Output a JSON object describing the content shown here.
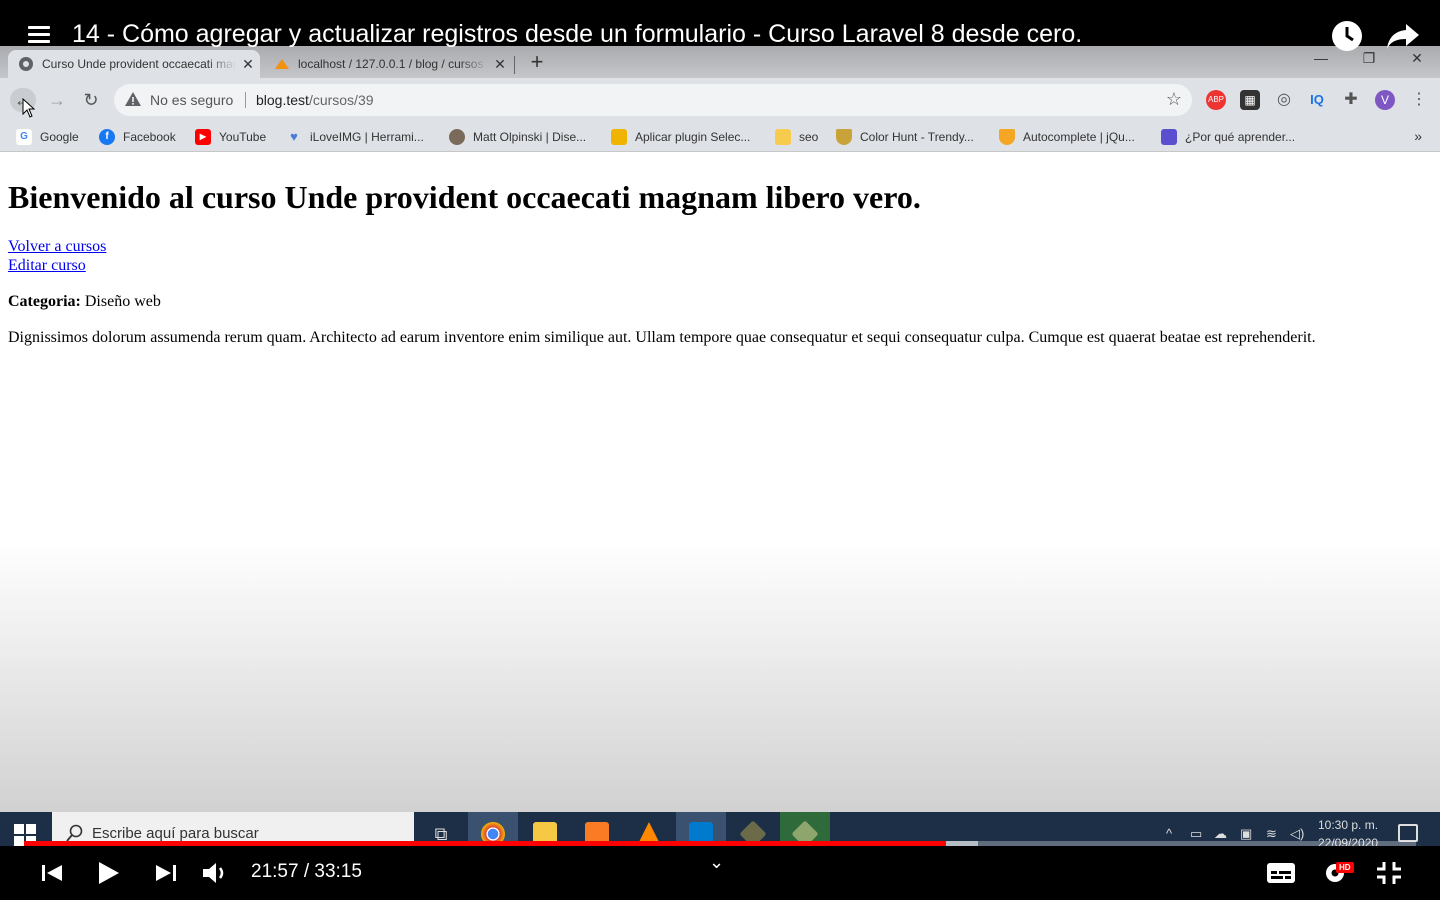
{
  "video": {
    "title": "14 - Cómo agregar y actualizar registros desde un formulario - Curso Laravel 8 desde cero.",
    "time": "21:57 / 33:15",
    "progress_played": 0.662,
    "progress_buffered": 0.685,
    "quality_badge": "HD"
  },
  "browser": {
    "tabs": [
      {
        "label": "Curso Unde provident occaecati magnam libero vero",
        "close": "✕"
      },
      {
        "label": "localhost / 127.0.0.1 / blog / cursos",
        "close": "✕"
      }
    ],
    "new_tab": "+",
    "security_label": "No es seguro",
    "url_host": "blog.test",
    "url_path": "/cursos/39",
    "profile_initial": "V",
    "bookmarks": [
      {
        "label": "Google",
        "color": "#4285f4",
        "glyph": "G"
      },
      {
        "label": "Facebook",
        "color": "#1877f2",
        "glyph": "f"
      },
      {
        "label": "YouTube",
        "color": "#ff0000",
        "glyph": "▶"
      },
      {
        "label": "iLoveIMG | Herrami...",
        "color": "#4a7bd6",
        "glyph": "♥"
      },
      {
        "label": "Matt Olpinski | Dise...",
        "color": "#7a6a5a",
        "glyph": ""
      },
      {
        "label": "Aplicar plugin Selec...",
        "color": "#f0b400",
        "glyph": ""
      },
      {
        "label": "seo",
        "color": "#f7cb4d",
        "glyph": ""
      },
      {
        "label": "Color Hunt - Trendy...",
        "color": "#c9a23a",
        "glyph": ""
      },
      {
        "label": "Autocomplete | jQu...",
        "color": "#f5a623",
        "glyph": ""
      },
      {
        "label": "¿Por qué aprender...",
        "color": "#5a4fcf",
        "glyph": ""
      }
    ],
    "bookmarks_more": "»"
  },
  "page": {
    "heading": "Bienvenido al curso Unde provident occaecati magnam libero vero.",
    "link_back": "Volver a cursos",
    "link_edit": "Editar curso",
    "category_label": "Categoria:",
    "category_value": " Diseño web",
    "description": "Dignissimos dolorum assumenda rerum quam. Architecto ad earum inventore enim similique aut. Ullam tempore quae consequatur et sequi consequatur culpa. Cumque est quaerat beatae est reprehenderit."
  },
  "taskbar": {
    "search_placeholder": "Escribe aquí para buscar",
    "time": "10:30 p. m.",
    "date": "22/09/2020"
  }
}
